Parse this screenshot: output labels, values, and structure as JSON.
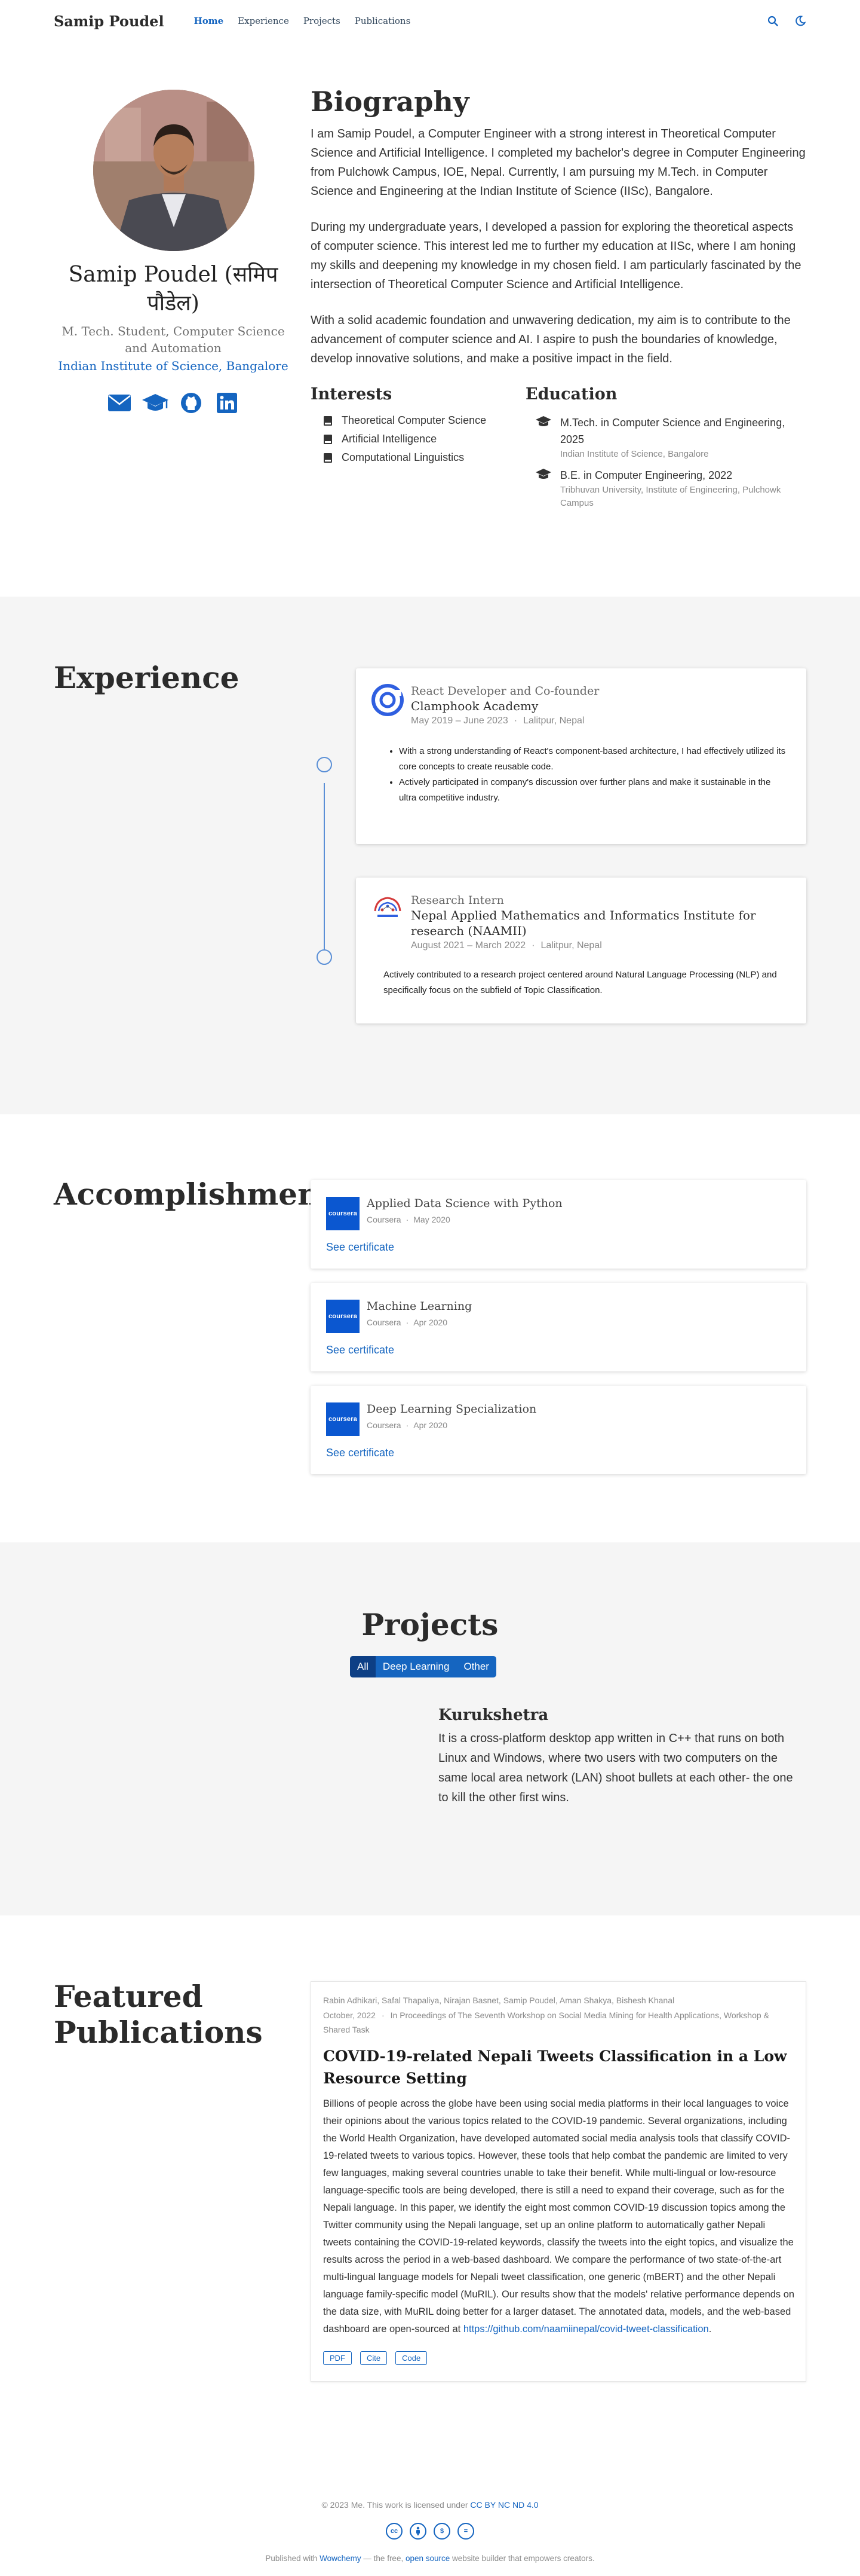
{
  "nav": {
    "brand": "Samip Poudel",
    "links": [
      "Home",
      "Experience",
      "Projects",
      "Publications"
    ],
    "icons": [
      "search-icon",
      "moon-icon"
    ]
  },
  "profile": {
    "name": "Samip Poudel (समिप पौडेल)",
    "role": "M. Tech. Student, Computer Science and Automation",
    "organization": "Indian Institute of Science, Bangalore",
    "social_icons": [
      "envelope-icon",
      "graduation-cap-icon",
      "github-icon",
      "linkedin-icon"
    ]
  },
  "biography": {
    "title": "Biography",
    "paragraphs": [
      "I am Samip Poudel, a Computer Engineer with a strong interest in Theoretical Computer Science and Artificial Intelligence. I completed my bachelor's degree in Computer Engineering from Pulchowk Campus, IOE, Nepal. Currently, I am pursuing my M.Tech. in Computer Science and Engineering at the Indian Institute of Science (IISc), Bangalore.",
      "During my undergraduate years, I developed a passion for exploring the theoretical aspects of computer science. This interest led me to further my education at IISc, where I am honing my skills and deepening my knowledge in my chosen field. I am particularly fascinated by the intersection of Theoretical Computer Science and Artificial Intelligence.",
      "With a solid academic foundation and unwavering dedication, my aim is to contribute to the advancement of computer science and AI. I aspire to push the boundaries of knowledge, develop innovative solutions, and make a positive impact in the field."
    ],
    "interests_title": "Interests",
    "interests": [
      "Theoretical Computer Science",
      "Artificial Intelligence",
      "Computational Linguistics"
    ],
    "education_title": "Education",
    "education": [
      {
        "course": "M.Tech. in Computer Science and Engineering, 2025",
        "institution": "Indian Institute of Science, Bangalore"
      },
      {
        "course": "B.E. in Computer Engineering, 2022",
        "institution": "Tribhuvan University, Institute of Engineering, Pulchowk Campus"
      }
    ]
  },
  "experience": {
    "title": "Experience",
    "items": [
      {
        "role": "React Developer and Co-founder",
        "organization": "Clamphook Academy",
        "dates": "May 2019 – June 2023",
        "location": "Lalitpur, Nepal",
        "bullets": [
          "With a strong understanding of React's component-based architecture, I had effectively utilized its core concepts to create reusable code.",
          "Actively participated in company's discussion over further plans and make it sustainable in the ultra competitive industry."
        ]
      },
      {
        "role": "Research Intern",
        "organization": "Nepal Applied Mathematics and Informatics Institute for research (NAAMII)",
        "dates": "August 2021 – March 2022",
        "location": "Lalitpur, Nepal",
        "description": "Actively contributed to a research project centered around Natural Language Processing (NLP) and specifically focus on the subfield of Topic Classification."
      }
    ]
  },
  "accomplishments": {
    "title": "Accomplishments",
    "items": [
      {
        "title": "Applied Data Science with Python",
        "org": "Coursera",
        "date": "May 2020",
        "link": "See certificate",
        "logo": "coursera"
      },
      {
        "title": "Machine Learning",
        "org": "Coursera",
        "date": "Apr 2020",
        "link": "See certificate",
        "logo": "coursera"
      },
      {
        "title": "Deep Learning Specialization",
        "org": "Coursera",
        "date": "Apr 2020",
        "link": "See certificate",
        "logo": "coursera"
      }
    ]
  },
  "projects": {
    "title": "Projects",
    "filters": [
      "All",
      "Deep Learning",
      "Other"
    ],
    "active_filter": "All",
    "items": [
      {
        "name": "Kurukshetra",
        "description": "It is a cross-platform desktop app written in C++ that runs on both Linux and Windows, where two users with two computers on the same local area network (LAN) shoot bullets at each other- the one to kill the other first wins."
      }
    ]
  },
  "publications": {
    "title": "Featured Publications",
    "items": [
      {
        "authors": "Rabin Adhikari, Safal Thapaliya, Nirajan Basnet, Samip Poudel, Aman Shakya, Bishesh Khanal",
        "date": "October, 2022",
        "venue": "In Proceedings of The Seventh Workshop on Social Media Mining for Health Applications, Workshop & Shared Task",
        "title": "COVID-19-related Nepali Tweets Classification in a Low Resource Setting",
        "abstract": "Billions of people across the globe have been using social media platforms in their local languages to voice their opinions about the various topics related to the COVID-19 pandemic. Several organizations, including the World Health Organization, have developed automated social media analysis tools that classify COVID-19-related tweets to various topics. However, these tools that help combat the pandemic are limited to very few languages, making several countries unable to take their benefit. While multi-lingual or low-resource language-specific tools are being developed, there is still a need to expand their coverage, such as for the Nepali language. In this paper, we identify the eight most common COVID-19 discussion topics among the Twitter community using the Nepali language, set up an online platform to automatically gather Nepali tweets containing the COVID-19-related keywords, classify the tweets into the eight topics, and visualize the results across the period in a web-based dashboard. We compare the performance of two state-of-the-art multi-lingual language models for Nepali tweet classification, one generic (mBERT) and the other Nepali language family-specific model (MuRIL). Our results show that the models' relative performance depends on the data size, with MuRIL doing better for a larger dataset. The annotated data, models, and the web-based dashboard are open-sourced at ",
        "link": "https://github.com/naamiinepal/covid-tweet-classification",
        "link_suffix": ".",
        "buttons": [
          "PDF",
          "Cite",
          "Code"
        ]
      }
    ]
  },
  "footer": {
    "copyright_prefix": "© 2023 Me. This work is licensed under ",
    "license": "CC BY NC ND 4.0",
    "cc_icons": [
      "cc-icon",
      "by-icon",
      "nc-icon",
      "nd-icon"
    ],
    "powered_prefix": "Published with ",
    "powered_tool": "Wowchemy",
    "powered_middle": " — the free, ",
    "powered_open": "open source",
    "powered_suffix": " website builder that empowers creators."
  },
  "colors": {
    "accent": "#1565c0",
    "section_alt_bg": "#f5f5f5",
    "timeline": "#5a8fd6",
    "coursera": "#0b57d0"
  }
}
